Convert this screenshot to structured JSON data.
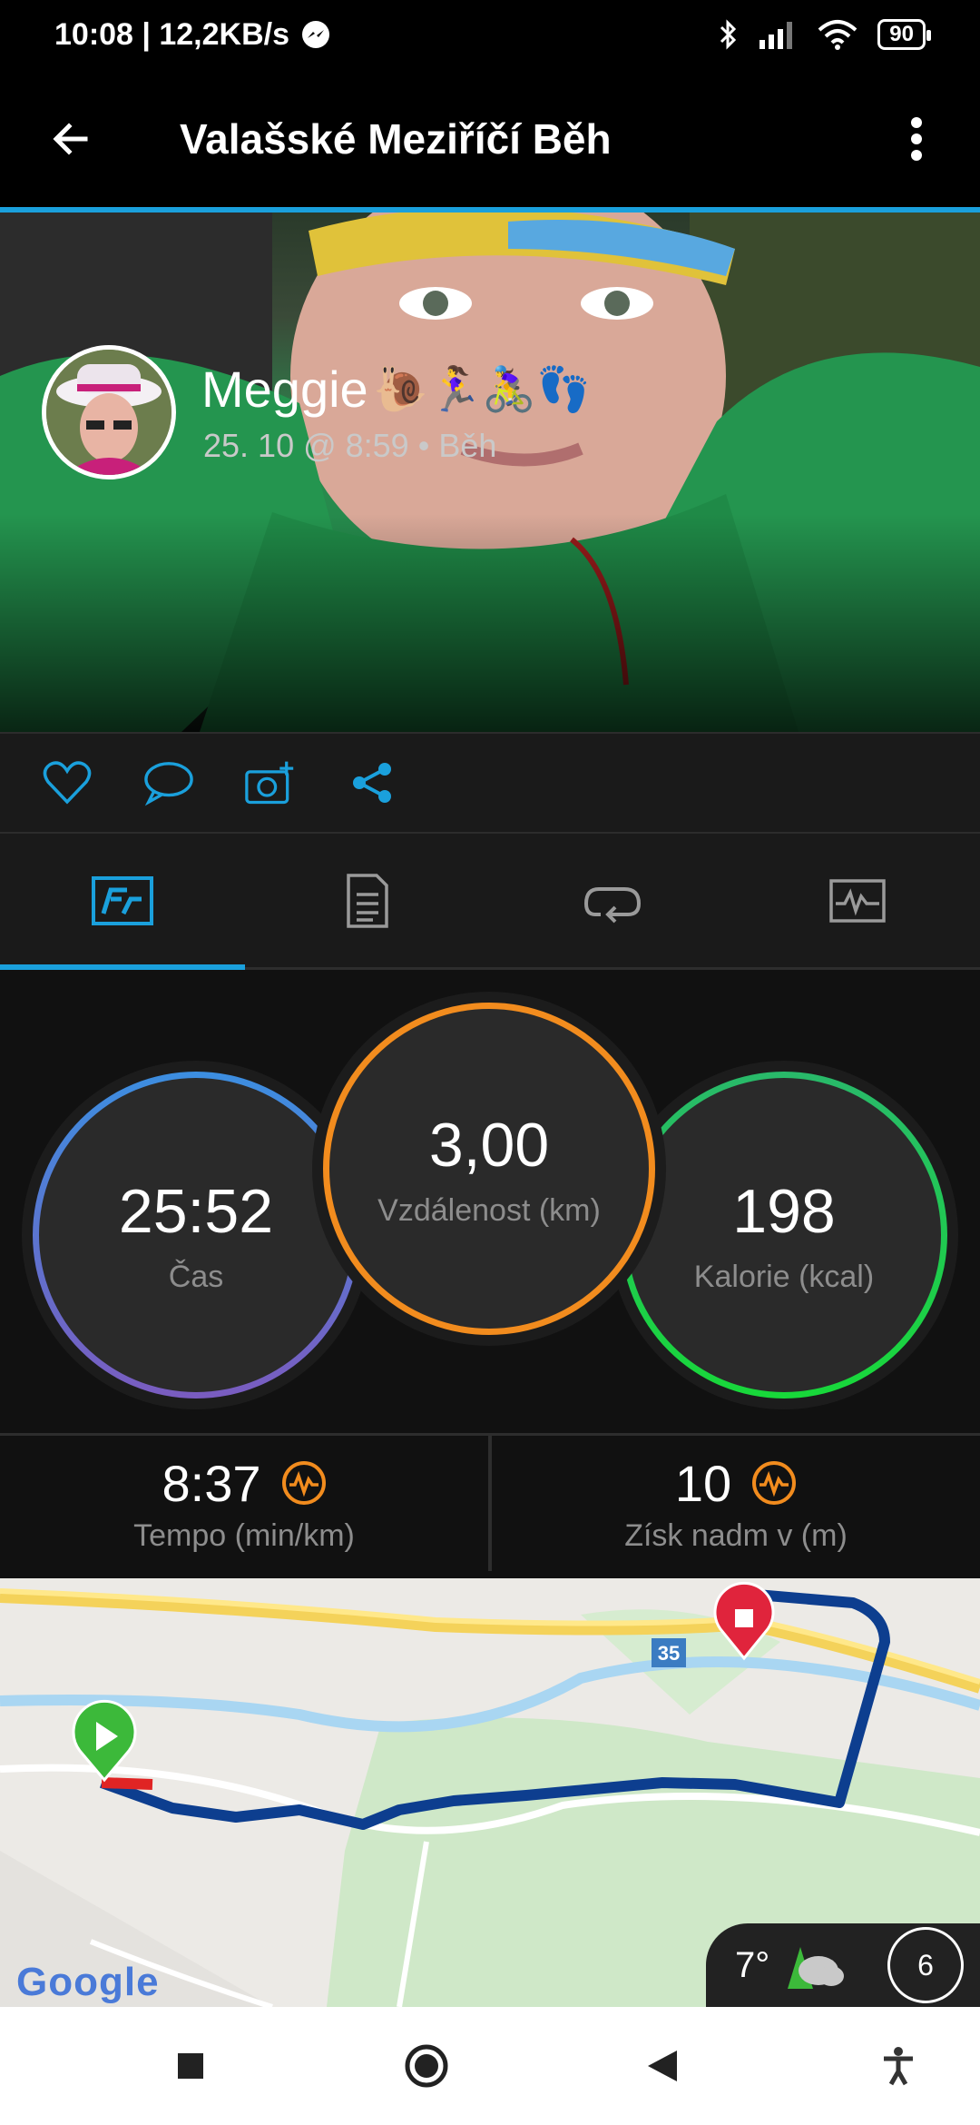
{
  "status_bar": {
    "time_speed": "10:08 | 12,2KB/s",
    "battery": "90"
  },
  "app_bar": {
    "title": "Valašské Meziříčí Běh"
  },
  "profile": {
    "name": "Meggie",
    "emoji": "🐌🏃‍♀️🚴‍♀️👣",
    "meta": "25. 10 @ 8:59 • Běh"
  },
  "actions": [
    "like-icon",
    "comment-icon",
    "add-photo-icon",
    "share-icon"
  ],
  "tabs": [
    {
      "icon": "stats-icon",
      "active": true
    },
    {
      "icon": "details-icon",
      "active": false
    },
    {
      "icon": "laps-icon",
      "active": false
    },
    {
      "icon": "chart-icon",
      "active": false
    }
  ],
  "stats": {
    "time": {
      "value": "25:52",
      "label": "Čas"
    },
    "distance": {
      "value": "3,00",
      "label": "Vzdálenost (km)"
    },
    "calories": {
      "value": "198",
      "label": "Kalorie (kcal)"
    }
  },
  "summary": {
    "pace": {
      "value": "8:37",
      "label": "Tempo (min/km)"
    },
    "elevation": {
      "value": "10",
      "label": "Získ nadm v (m)"
    }
  },
  "map": {
    "road_number": "35",
    "attribution": "Google"
  },
  "weather": {
    "temp": "7°",
    "wind": "6"
  },
  "colors": {
    "accent": "#1aa0dc",
    "distance_ring": "#f28c1e",
    "calories_ring": "#18d83a",
    "route": "#0d3e8f"
  }
}
